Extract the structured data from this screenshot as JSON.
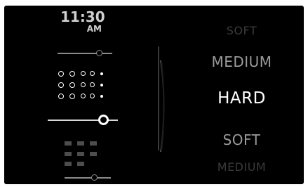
{
  "clock": {
    "time": "11:30",
    "ampm": "AM"
  },
  "sliders": [
    {
      "name": "top",
      "level": 0.8,
      "active": false
    },
    {
      "name": "middle",
      "level": 0.79,
      "active": true
    },
    {
      "name": "bottom",
      "level": 0.62,
      "active": false
    }
  ],
  "colors": {
    "background": "#000000",
    "selected_text": "#ffffff",
    "near_text": "#9a9a9a",
    "far_text": "#3a3a3a",
    "inactive_grid": "#4d4d4d"
  },
  "picker": {
    "items": [
      "SOFT",
      "MEDIUM",
      "HARD",
      "SOFT",
      "MEDIUM"
    ],
    "selected": "HARD"
  }
}
